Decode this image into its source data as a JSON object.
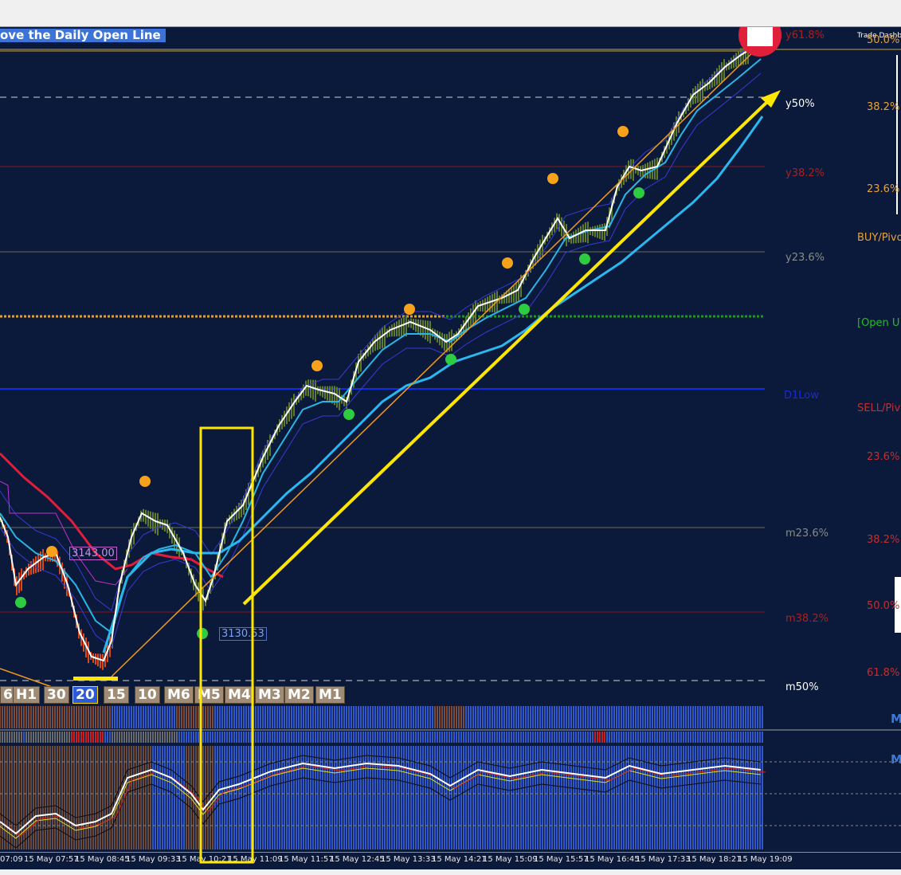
{
  "banner": {
    "text": "ove the Daily Open Line"
  },
  "dashboard": {
    "label": "Trade Dashb"
  },
  "levels": {
    "y618": "y61.8%",
    "y50": "y50%",
    "y382": "y38.2%",
    "y236": "y23.6%",
    "d1low": "D1Low",
    "m236": "m23.6%",
    "m382": "m38.2%",
    "m50": "m50%"
  },
  "right_labels": {
    "fib_500_top": "50.0%",
    "fib_382_a": "38.2%",
    "fib_236_a": "23.6%",
    "buy_pivot": "BUY/Pivo",
    "open_line": "[Open U",
    "sell_pivot": "SELL/Pivo",
    "fib_236_b": "23.6%",
    "fib_382_b": "38.2%",
    "fib_500_b": "50.0%",
    "fib_618_b": "61.8%"
  },
  "price_tags": {
    "upper": "3143.00",
    "lower": "3130.53"
  },
  "timeframes": [
    "6",
    "H1",
    "30",
    "20",
    "15",
    "10",
    "M6",
    "M5",
    "M4",
    "M3",
    "M2",
    "M1"
  ],
  "active_timeframe": "20",
  "sub_labels": {
    "sub1": "M",
    "sub2": "M"
  },
  "time_ticks": [
    "07:09",
    "15 May 07:57",
    "15 May 08:45",
    "15 May 09:33",
    "15 May 10:21",
    "15 May 11:09",
    "15 May 11:57",
    "15 May 12:45",
    "15 May 13:33",
    "15 May 14:21",
    "15 May 15:09",
    "15 May 15:57",
    "15 May 16:45",
    "15 May 17:33",
    "15 May 18:21",
    "15 May 19:09"
  ],
  "colors": {
    "background": "#0b1a3a",
    "annotation": "#ffe600",
    "fast_ma": "#ffffff",
    "mid_ma": "#27b6e6",
    "slow_ma": "#e01e3c",
    "open_line": "#e0a030",
    "open_line_green": "#1a9a1a",
    "d1low": "#1030e0",
    "swing_high_dot": "#f7a21a",
    "swing_low_dot": "#2ecc40"
  }
}
